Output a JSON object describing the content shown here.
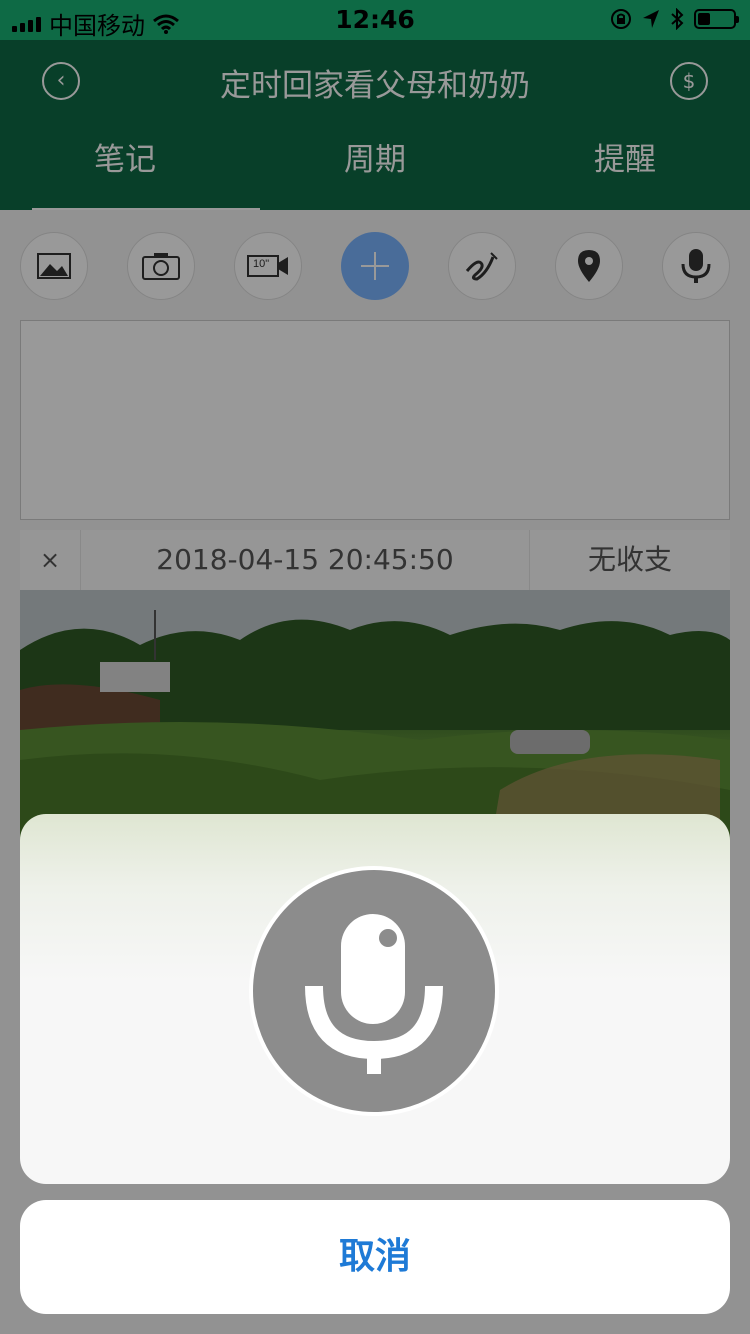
{
  "status_bar": {
    "carrier": "中国移动",
    "time": "12:46",
    "battery_level": 0.35
  },
  "header": {
    "title": "定时回家看父母和奶奶",
    "back_icon": "chevron-left-icon",
    "coin_icon": "dollar-coin-icon",
    "coin_symbol": "$",
    "tabs": [
      {
        "label": "笔记",
        "active": true
      },
      {
        "label": "周期",
        "active": false
      },
      {
        "label": "提醒",
        "active": false
      }
    ]
  },
  "toolbar": {
    "items": [
      {
        "icon": "image-icon"
      },
      {
        "icon": "camera-icon"
      },
      {
        "icon": "video-icon",
        "text": "10\""
      },
      {
        "icon": "add-icon"
      },
      {
        "icon": "handwriting-icon"
      },
      {
        "icon": "location-pin-icon"
      },
      {
        "icon": "microphone-icon"
      }
    ]
  },
  "note": {
    "close_symbol": "×",
    "datetime": "2018-04-15 20:45:50",
    "income_status": "无收支"
  },
  "voice_sheet": {
    "mic_icon": "microphone-icon",
    "cancel_label": "取消"
  },
  "colors": {
    "header_green": "#0e6a45",
    "accent_blue": "#1e7ad6",
    "add_button_blue": "#7ab4ff"
  }
}
